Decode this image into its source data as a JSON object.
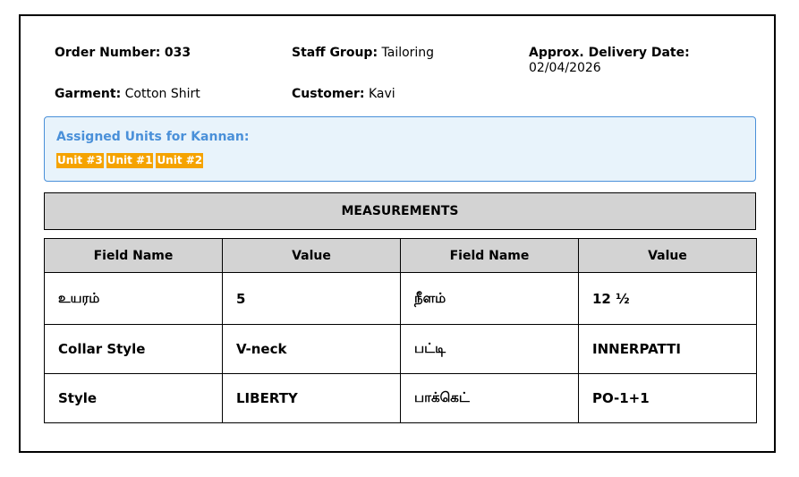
{
  "order": {
    "number_label": "Order Number:",
    "number_value": "033",
    "staff_label": "Staff Group:",
    "staff_value": "Tailoring",
    "delivery_label": "Approx. Delivery Date:",
    "delivery_value": "02/04/2026",
    "garment_label": "Garment:",
    "garment_value": "Cotton Shirt",
    "customer_label": "Customer:",
    "customer_value": "Kavi"
  },
  "assigned": {
    "title": "Assigned Units for Kannan:",
    "units": [
      "Unit #3",
      "Unit #1",
      "Unit #2"
    ],
    "accent_color": "#4a90d9",
    "badge_color": "#f5a300"
  },
  "measurements": {
    "title": "MEASUREMENTS",
    "headers": [
      "Field Name",
      "Value",
      "Field Name",
      "Value"
    ],
    "rows": [
      [
        "உயரம்",
        "5",
        "நீளம்",
        "12 ½"
      ],
      [
        "Collar Style",
        "V-neck",
        "பட்டி",
        "INNERPATTI"
      ],
      [
        "Style",
        "LIBERTY",
        "பாக்கெட்",
        "PO-1+1"
      ]
    ]
  }
}
